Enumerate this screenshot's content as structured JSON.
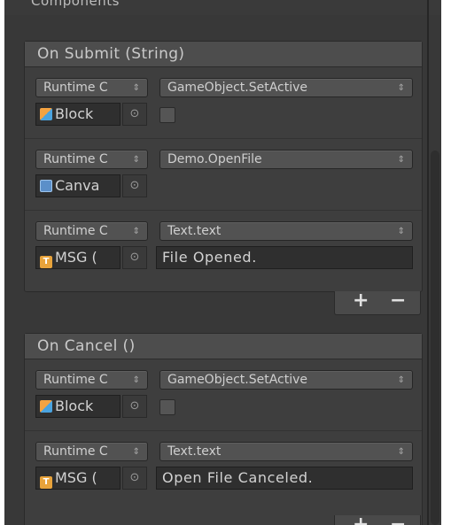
{
  "panel": {
    "header": "Components"
  },
  "events": [
    {
      "title": "On Submit (String)",
      "entries": [
        {
          "runtime": "Runtime C",
          "method": "GameObject.SetActive",
          "object": "Block",
          "icon": "gameobject-cube-icon"
        },
        {
          "runtime": "Runtime C",
          "method": "Demo.OpenFile",
          "object": "Canva",
          "icon": "canvas-script-icon"
        },
        {
          "runtime": "Runtime C",
          "method": "Text.text",
          "object": "MSG (",
          "icon": "text-component-icon",
          "value": "File Opened."
        }
      ]
    },
    {
      "title": "On Cancel ()",
      "entries": [
        {
          "runtime": "Runtime C",
          "method": "GameObject.SetActive",
          "object": "Block",
          "icon": "gameobject-cube-icon"
        },
        {
          "runtime": "Runtime C",
          "method": "Text.text",
          "object": "MSG (",
          "icon": "text-component-icon",
          "value": "Open File Canceled."
        }
      ]
    }
  ],
  "controls": {
    "add": "+",
    "remove": "−",
    "dropdown_arrow": "⇕",
    "picker": "⊙"
  },
  "colors": {
    "panel_bg": "#383838",
    "field_bg": "#2f2f2f",
    "header_bg": "#4d4d4d"
  }
}
